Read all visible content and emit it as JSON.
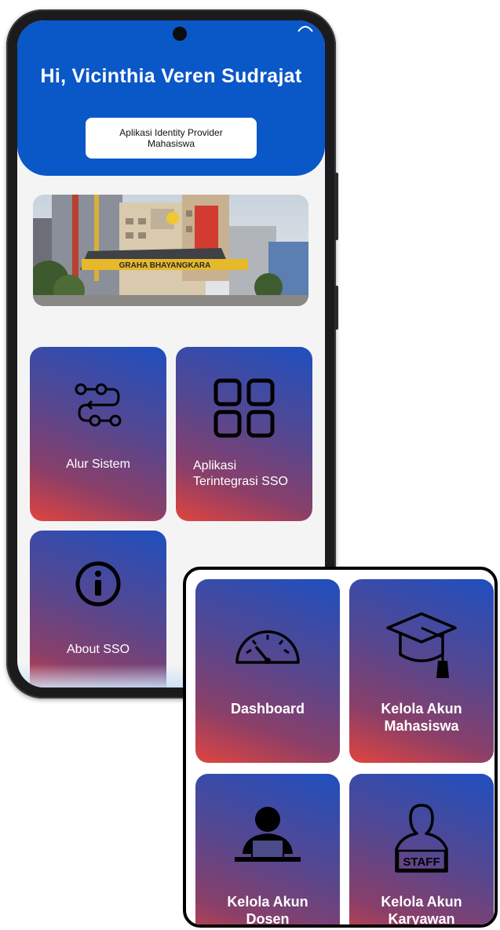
{
  "header": {
    "greeting": "Hi, Vicinthia Veren Sudrajat",
    "app_name_line1": "Aplikasi Identity Provider",
    "app_name_line2": "Mahasiswa"
  },
  "banner": {
    "building_sign": "GRAHA BHAYANGKARA",
    "image_icon": "campus-building-photo"
  },
  "menu": [
    {
      "label": "Alur Sistem",
      "icon": "flow-icon"
    },
    {
      "label_line1": "Aplikasi",
      "label_line2": "Terintegrasi SSO",
      "icon": "grid-apps-icon"
    },
    {
      "label": "About SSO",
      "icon": "info-icon"
    }
  ],
  "admin_menu": [
    {
      "label": "Dashboard",
      "icon": "speedometer-icon"
    },
    {
      "label_line1": "Kelola Akun",
      "label_line2": "Mahasiswa",
      "icon": "graduation-cap-icon"
    },
    {
      "label_line1": "Kelola Akun",
      "label_line2": "Dosen",
      "icon": "lecturer-icon"
    },
    {
      "label_line1": "Kelola Akun",
      "label_line2": "Karyawan",
      "icon": "staff-icon",
      "badge": "STAFF"
    }
  ],
  "colors": {
    "header_blue": "#0a57c8",
    "tile_gradient_top": "#1f4fbf",
    "tile_gradient_bottom": "#e2443e"
  }
}
